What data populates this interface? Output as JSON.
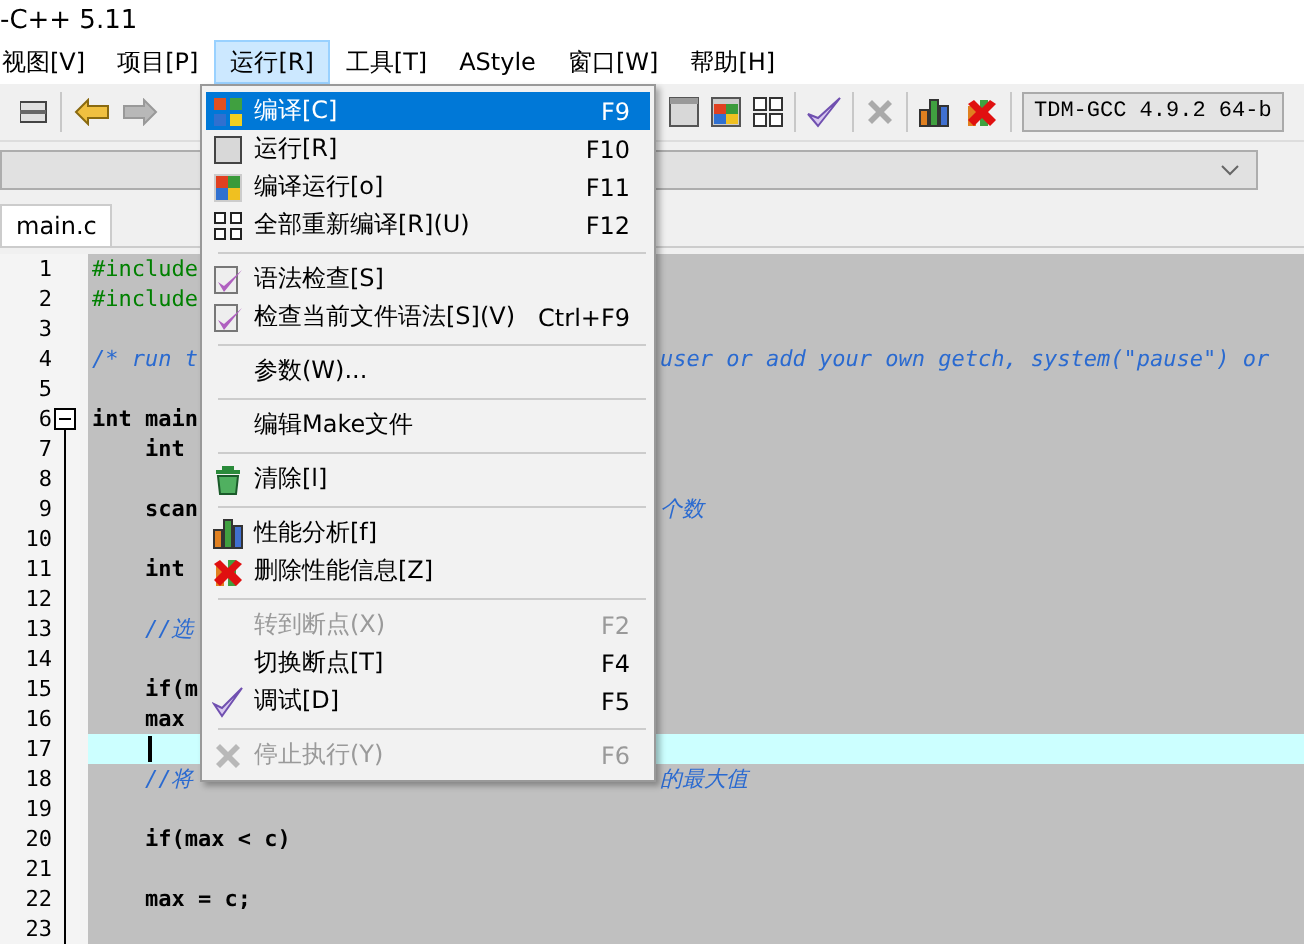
{
  "window": {
    "title": "-C++ 5.11"
  },
  "menubar": [
    {
      "label": "视图[V]",
      "selected": false
    },
    {
      "label": "项目[P]",
      "selected": false
    },
    {
      "label": "运行[R]",
      "selected": true
    },
    {
      "label": "工具[T]",
      "selected": false
    },
    {
      "label": "AStyle",
      "selected": false
    },
    {
      "label": "窗口[W]",
      "selected": false
    },
    {
      "label": "帮助[H]",
      "selected": false
    }
  ],
  "toolbar": {
    "compiler": "TDM-GCC 4.9.2 64-b"
  },
  "tabs": [
    {
      "label": "main.c",
      "selected": true
    }
  ],
  "editor": {
    "lines": [
      {
        "number": "1",
        "kind": "directive",
        "left": "#include"
      },
      {
        "number": "2",
        "kind": "directive",
        "left": "#include"
      },
      {
        "number": "3",
        "kind": "code"
      },
      {
        "number": "4",
        "kind": "comment",
        "left": "/* run t",
        "right": "user or add your own getch, system(\"pause\") or"
      },
      {
        "number": "5",
        "kind": "code"
      },
      {
        "number": "6",
        "kind": "code",
        "left": "int main"
      },
      {
        "number": "7",
        "kind": "code",
        "left": "    int"
      },
      {
        "number": "8",
        "kind": "code"
      },
      {
        "number": "9",
        "kind": "code",
        "left": "    scan",
        "right": "个数"
      },
      {
        "number": "10",
        "kind": "code"
      },
      {
        "number": "11",
        "kind": "code",
        "left": "    int"
      },
      {
        "number": "12",
        "kind": "code"
      },
      {
        "number": "13",
        "kind": "comment",
        "left": "    //选"
      },
      {
        "number": "14",
        "kind": "code"
      },
      {
        "number": "15",
        "kind": "code",
        "left": "    if(m"
      },
      {
        "number": "16",
        "kind": "code",
        "left": "    max"
      },
      {
        "number": "17",
        "kind": "current"
      },
      {
        "number": "18",
        "kind": "comment",
        "left": "    //将",
        "right": "的最大值"
      },
      {
        "number": "19",
        "kind": "code"
      },
      {
        "number": "20",
        "kind": "code",
        "left": "    if(max < c)"
      },
      {
        "number": "21",
        "kind": "code"
      },
      {
        "number": "22",
        "kind": "code",
        "left": "    max = c;"
      },
      {
        "number": "23",
        "kind": "code"
      }
    ]
  },
  "run_menu": {
    "items": [
      {
        "kind": "item",
        "label": "编译[C]",
        "shortcut": "F9",
        "selected": true,
        "disabled": false
      },
      {
        "kind": "item",
        "label": "运行[R]",
        "shortcut": "F10",
        "selected": false,
        "disabled": false
      },
      {
        "kind": "item",
        "label": "编译运行[o]",
        "shortcut": "F11",
        "selected": false,
        "disabled": false
      },
      {
        "kind": "item",
        "label": "全部重新编译[R](U)",
        "shortcut": "F12",
        "selected": false,
        "disabled": false
      },
      {
        "kind": "separator"
      },
      {
        "kind": "item",
        "label": "语法检查[S]",
        "selected": false,
        "disabled": false
      },
      {
        "kind": "item",
        "label": "检查当前文件语法[S](V)",
        "shortcut": "Ctrl+F9",
        "selected": false,
        "disabled": false
      },
      {
        "kind": "separator"
      },
      {
        "kind": "item",
        "label": "参数(W)...",
        "selected": false,
        "disabled": false
      },
      {
        "kind": "separator"
      },
      {
        "kind": "item",
        "label": "编辑Make文件",
        "selected": false,
        "disabled": false
      },
      {
        "kind": "separator"
      },
      {
        "kind": "item",
        "label": "清除[l]",
        "selected": false,
        "disabled": false
      },
      {
        "kind": "separator"
      },
      {
        "kind": "item",
        "label": "性能分析[f]",
        "selected": false,
        "disabled": false
      },
      {
        "kind": "item",
        "label": "删除性能信息[Z]",
        "selected": false,
        "disabled": false
      },
      {
        "kind": "separator"
      },
      {
        "kind": "item",
        "label": "转到断点(X)",
        "shortcut": "F2",
        "selected": false,
        "disabled": true
      },
      {
        "kind": "item",
        "label": "切换断点[T]",
        "shortcut": "F4",
        "selected": false,
        "disabled": false
      },
      {
        "kind": "item",
        "label": "调试[D]",
        "shortcut": "F5",
        "selected": false,
        "disabled": false
      },
      {
        "kind": "separator"
      },
      {
        "kind": "item",
        "label": "停止执行(Y)",
        "shortcut": "F6",
        "selected": false,
        "disabled": true
      }
    ]
  }
}
